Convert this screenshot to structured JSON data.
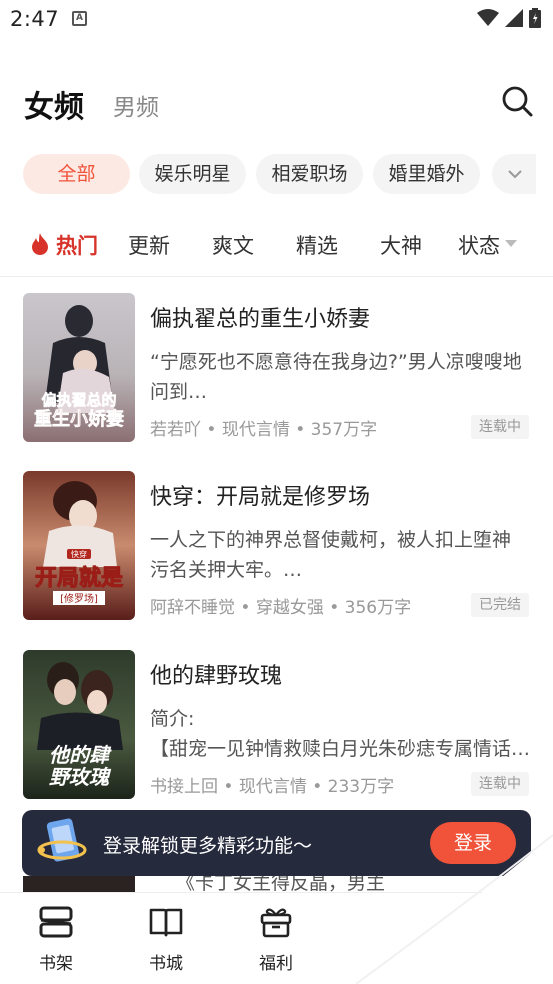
{
  "status_bar": {
    "time": "2:47",
    "notification_glyph": "A"
  },
  "header": {
    "tabs": [
      {
        "label": "女频",
        "active": true
      },
      {
        "label": "男频",
        "active": false
      }
    ]
  },
  "categories": {
    "items": [
      {
        "label": "全部",
        "active": true
      },
      {
        "label": "娱乐明星",
        "active": false
      },
      {
        "label": "相爱职场",
        "active": false
      },
      {
        "label": "婚里婚外",
        "active": false
      }
    ]
  },
  "sort_tabs": {
    "items": [
      {
        "label": "热门",
        "active": true,
        "icon": "flame-icon"
      },
      {
        "label": "更新"
      },
      {
        "label": "爽文"
      },
      {
        "label": "精选"
      },
      {
        "label": "大神"
      },
      {
        "label": "状态",
        "icon": "triangle-down-icon"
      }
    ]
  },
  "books": [
    {
      "title": "偏执翟总的重生小娇妻",
      "desc_line1": "“宁愿死也不愿意待在我身边?”男人凉嗖嗖地",
      "desc_line2": "问到…",
      "meta": "若若吖 • 现代言情 • 357万字",
      "status": "连载中",
      "cover_text": "偏执翟总的重生小娇妻"
    },
    {
      "title": "快穿：开局就是修罗场",
      "desc_line1": "一人之下的神界总督使戴柯，被人扣上堕神",
      "desc_line2": "污名关押大牢。…",
      "meta": "阿辞不睡觉 • 穿越女强 • 356万字",
      "status": "已完结",
      "cover_text": "开局就是修罗场"
    },
    {
      "title": "他的肆野玫瑰",
      "desc_line1": "简介:",
      "desc_line2": "【甜宠一见钟情救赎白月光朱砂痣专属情话…",
      "meta": "书接上回 • 现代言情 • 233万字",
      "status": "连载中",
      "cover_text": "他的肆野玫瑰"
    }
  ],
  "peek_text": "《卡丁女主得反晶，男主",
  "login_banner": {
    "text": "登录解锁更多精彩功能～",
    "button": "登录"
  },
  "bottom_nav": [
    {
      "label": "书架",
      "icon": "bookshelf-icon"
    },
    {
      "label": "书城",
      "icon": "book-open-icon"
    },
    {
      "label": "福利",
      "icon": "gift-icon"
    }
  ],
  "colors": {
    "accent": "#f0533a",
    "hot": "#d8332a",
    "banner_bg": "#262a3d",
    "chip_bg": "#f4f4f4",
    "chip_active_bg": "#fde9e4"
  }
}
